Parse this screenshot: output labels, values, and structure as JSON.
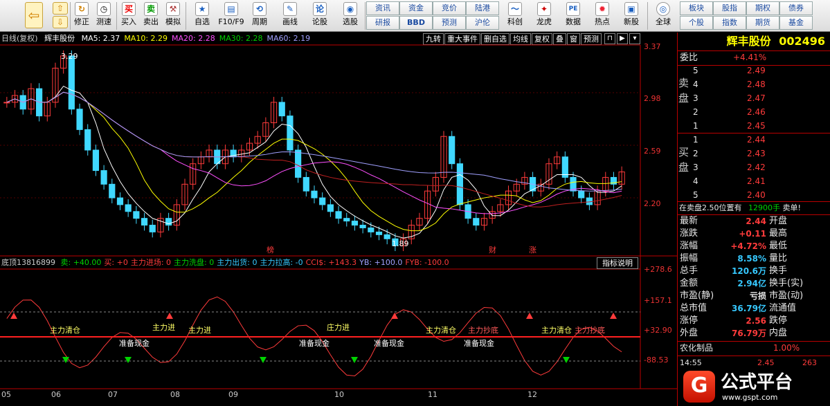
{
  "toolbar": {
    "left_buttons": [
      {
        "label": "修正",
        "icon": "refresh-icon"
      },
      {
        "label": "测速",
        "icon": "clock-icon"
      },
      {
        "label": "买入",
        "icon": "buy-icon",
        "glyph": "买"
      },
      {
        "label": "卖出",
        "icon": "sell-icon",
        "glyph": "卖"
      },
      {
        "label": "模拟",
        "icon": "hammer-icon"
      },
      {
        "label": "自选",
        "icon": "star-icon"
      },
      {
        "label": "F10/F9",
        "icon": "f10-icon"
      },
      {
        "label": "周期",
        "icon": "cycle-icon"
      },
      {
        "label": "画线",
        "icon": "pencil-icon"
      },
      {
        "label": "论股",
        "icon": "discuss-icon",
        "glyph": "论"
      },
      {
        "label": "选股",
        "icon": "select-stock-icon"
      }
    ],
    "grid_buttons": [
      [
        "资讯",
        "资金",
        "竞价",
        "陆港"
      ],
      [
        "研报",
        "BBD",
        "预测",
        "沪伦"
      ]
    ],
    "right_buttons": [
      {
        "label": "科创",
        "icon": "kechuang-icon"
      },
      {
        "label": "龙虎",
        "icon": "dragon-tiger-icon"
      },
      {
        "label": "数据",
        "icon": "pe-icon",
        "glyph": "PE"
      },
      {
        "label": "热点",
        "icon": "hot-icon"
      },
      {
        "label": "新股",
        "icon": "ipo-icon"
      },
      {
        "label": "全球",
        "icon": "globe-icon"
      }
    ],
    "far_right_grid": [
      [
        "板块",
        "股指",
        "期权",
        "债券"
      ],
      [
        "个股",
        "指数",
        "期货",
        "基金"
      ]
    ]
  },
  "chart": {
    "info_left": "日线(复权)",
    "stock_name_short": "辉丰股份",
    "ma": [
      {
        "label": "MA5: 2.37",
        "color": "#ffffff"
      },
      {
        "label": "MA10: 2.29",
        "color": "#ffff00"
      },
      {
        "label": "MA20: 2.28",
        "color": "#ff50ff"
      },
      {
        "label": "MA30: 2.28",
        "color": "#00d200"
      },
      {
        "label": "MA60: 2.19",
        "color": "#a0a0ff"
      }
    ],
    "tabs": [
      "九转",
      "重大事件",
      "删自选",
      "均线",
      "复权",
      "叠",
      "窗",
      "预测"
    ],
    "price_axis": [
      "3.37",
      "2.98",
      "2.59",
      "2.20"
    ],
    "high_marker": "3.29",
    "low_marker": "1.89",
    "event_labels": [
      "榜",
      "财",
      "涨"
    ],
    "x_axis": [
      "05",
      "06",
      "07",
      "08",
      "09",
      "10",
      "11",
      "12"
    ]
  },
  "indicator": {
    "title": "底顶13816899",
    "items": [
      {
        "label": "卖: +40.00",
        "color": "#00d200"
      },
      {
        "label": "买: +0",
        "color": "#ff3b3b"
      },
      {
        "label": "主力进场: 0",
        "color": "#ff3b3b"
      },
      {
        "label": "主力洗盘: 0",
        "color": "#00d200"
      },
      {
        "label": "主力出货: 0",
        "color": "#36c8ff"
      },
      {
        "label": "主力拉高: -0",
        "color": "#36c8ff"
      },
      {
        "label": "CCI$: +143.3",
        "color": "#ff3b3b"
      },
      {
        "label": "YB: +100.0",
        "color": "#a0a0ff"
      },
      {
        "label": "FYB: -100.0",
        "color": "#ff3b3b"
      }
    ],
    "explain_button": "指标说明",
    "axis": [
      "+278.6",
      "+157.1",
      "+32.90",
      "-88.53"
    ],
    "annotations": [
      "主力清仓",
      "主力进",
      "准备现金",
      "主力进",
      "准备现金",
      "庄力进",
      "准备现金",
      "主力清仓",
      "主力抄底",
      "准备现金",
      "主力清仓",
      "主力抄底"
    ]
  },
  "panel": {
    "stock_name": "辉丰股份",
    "stock_code": "002496",
    "weibi_label": "委比",
    "weibi_value": "+4.41%",
    "sell_label": "卖盘",
    "buy_label": "买盘",
    "sells": [
      {
        "n": "5",
        "p": "2.49"
      },
      {
        "n": "4",
        "p": "2.48"
      },
      {
        "n": "3",
        "p": "2.47"
      },
      {
        "n": "2",
        "p": "2.46"
      },
      {
        "n": "1",
        "p": "2.45"
      }
    ],
    "buys": [
      {
        "n": "1",
        "p": "2.44"
      },
      {
        "n": "2",
        "p": "2.43"
      },
      {
        "n": "3",
        "p": "2.42"
      },
      {
        "n": "4",
        "p": "2.41"
      },
      {
        "n": "5",
        "p": "2.40"
      }
    ],
    "notice_left": "在卖盘2.50位置有",
    "notice_qty": "12900手",
    "notice_right": "卖单!",
    "stats": [
      {
        "l": "最新",
        "v": "2.44",
        "vc": "red",
        "r": "开盘",
        "rv": ""
      },
      {
        "l": "涨跌",
        "v": "+0.11",
        "vc": "red",
        "r": "最高",
        "rv": ""
      },
      {
        "l": "涨幅",
        "v": "+4.72%",
        "vc": "red",
        "r": "最低",
        "rv": ""
      },
      {
        "l": "振幅",
        "v": "8.58%",
        "vc": "cyan",
        "r": "量比",
        "rv": ""
      },
      {
        "l": "总手",
        "v": "120.6万",
        "vc": "cyan",
        "r": "换手",
        "rv": ""
      },
      {
        "l": "金额",
        "v": "2.94亿",
        "vc": "cyan",
        "r": "换手(实)",
        "rv": ""
      },
      {
        "l": "市盈(静)",
        "v": "亏损",
        "vc": "wht",
        "r": "市盈(动)",
        "rv": ""
      },
      {
        "l": "总市值",
        "v": "36.79亿",
        "vc": "cyan",
        "r": "流通值",
        "rv": ""
      },
      {
        "l": "涨停",
        "v": "2.56",
        "vc": "red",
        "r": "跌停",
        "rv": ""
      },
      {
        "l": "外盘",
        "v": "76.79万",
        "vc": "red",
        "r": "内盘",
        "rv": ""
      }
    ],
    "sector_name": "农化制品",
    "sector_change": "1.00%",
    "tick_time": "14:55",
    "tick_price": "2.45",
    "tick_vol": "263"
  },
  "watermark": {
    "brand": "公式平台",
    "url": "www.gspt.com"
  }
}
